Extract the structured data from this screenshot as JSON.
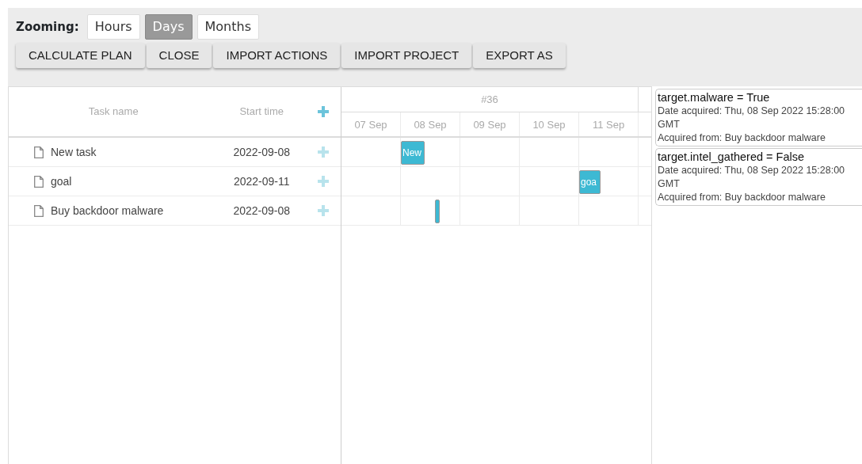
{
  "zooming": {
    "label": "Zooming:",
    "options": [
      {
        "label": "Hours",
        "selected": false
      },
      {
        "label": "Days",
        "selected": true
      },
      {
        "label": "Months",
        "selected": false
      }
    ]
  },
  "actions": [
    "CALCULATE PLAN",
    "CLOSE",
    "IMPORT ACTIONS",
    "IMPORT PROJECT",
    "EXPORT AS"
  ],
  "grid": {
    "columns": [
      "Task name",
      "Start time"
    ],
    "rows": [
      {
        "name": "New task",
        "start_time": "2022-09-08",
        "bar_label": "New"
      },
      {
        "name": "goal",
        "start_time": "2022-09-11",
        "bar_label": "goa"
      },
      {
        "name": "Buy backdoor malware",
        "start_time": "2022-09-08"
      }
    ]
  },
  "timeline": {
    "week": "#36",
    "days": [
      "07 Sep",
      "08 Sep",
      "09 Sep",
      "10 Sep",
      "11 Sep"
    ]
  },
  "facts": [
    {
      "title": "target.malware = True",
      "date": "Date acquired: Thu, 08 Sep 2022 15:28:00 GMT",
      "source": "Acquired from: Buy backdoor malware"
    },
    {
      "title": "target.intel_gathered = False",
      "date": "Date acquired: Thu, 08 Sep 2022 15:28:00 GMT",
      "source": "Acquired from: Buy backdoor malware"
    }
  ]
}
